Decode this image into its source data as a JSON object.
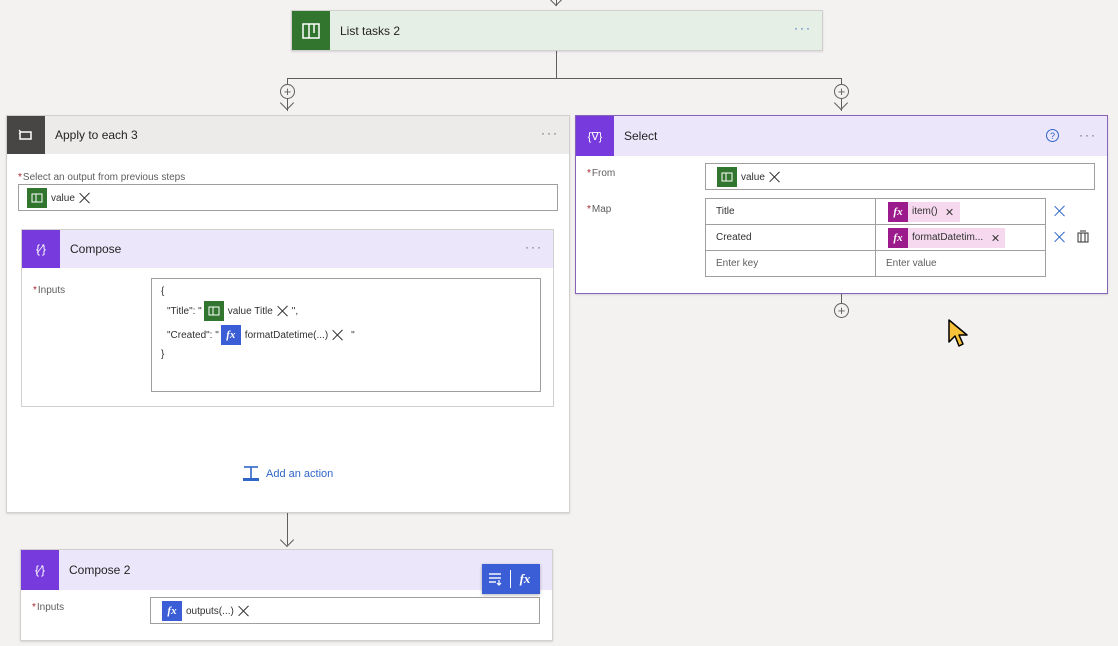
{
  "list_tasks": {
    "title": "List tasks 2",
    "more": "···"
  },
  "apply_each": {
    "title": "Apply to each 3",
    "more": "···",
    "select_label": "Select an output from previous steps",
    "token_value": "value",
    "add_action": "Add an action"
  },
  "compose": {
    "title": "Compose",
    "more": "···",
    "inputs_label": "Inputs",
    "open_brace": "{",
    "title_key": "\"Title\": \"",
    "title_token": "value Title",
    "title_end": "\",",
    "created_key": "\"Created\": \"",
    "created_token": "formatDatetime(...)",
    "created_end": "\"",
    "close_brace": "}"
  },
  "compose2": {
    "title": "Compose 2",
    "inputs_label": "Inputs",
    "token": "outputs(...)",
    "fx_label": "fx"
  },
  "select": {
    "title": "Select",
    "more": "···",
    "from_label": "From",
    "from_token": "value",
    "map_label": "Map",
    "rows": [
      {
        "key": "Title",
        "value": "item()"
      },
      {
        "key": "Created",
        "value": "formatDatetim..."
      }
    ],
    "key_placeholder": "Enter key",
    "value_placeholder": "Enter value"
  },
  "icons": {
    "fx": "fx",
    "required": "*"
  },
  "colors": {
    "planner_green": "#31752f",
    "data_op_purple": "#773adc",
    "loop_gray": "#484644",
    "expression_blue": "#3b5ed6",
    "expression_magenta": "#9c1b8c"
  }
}
